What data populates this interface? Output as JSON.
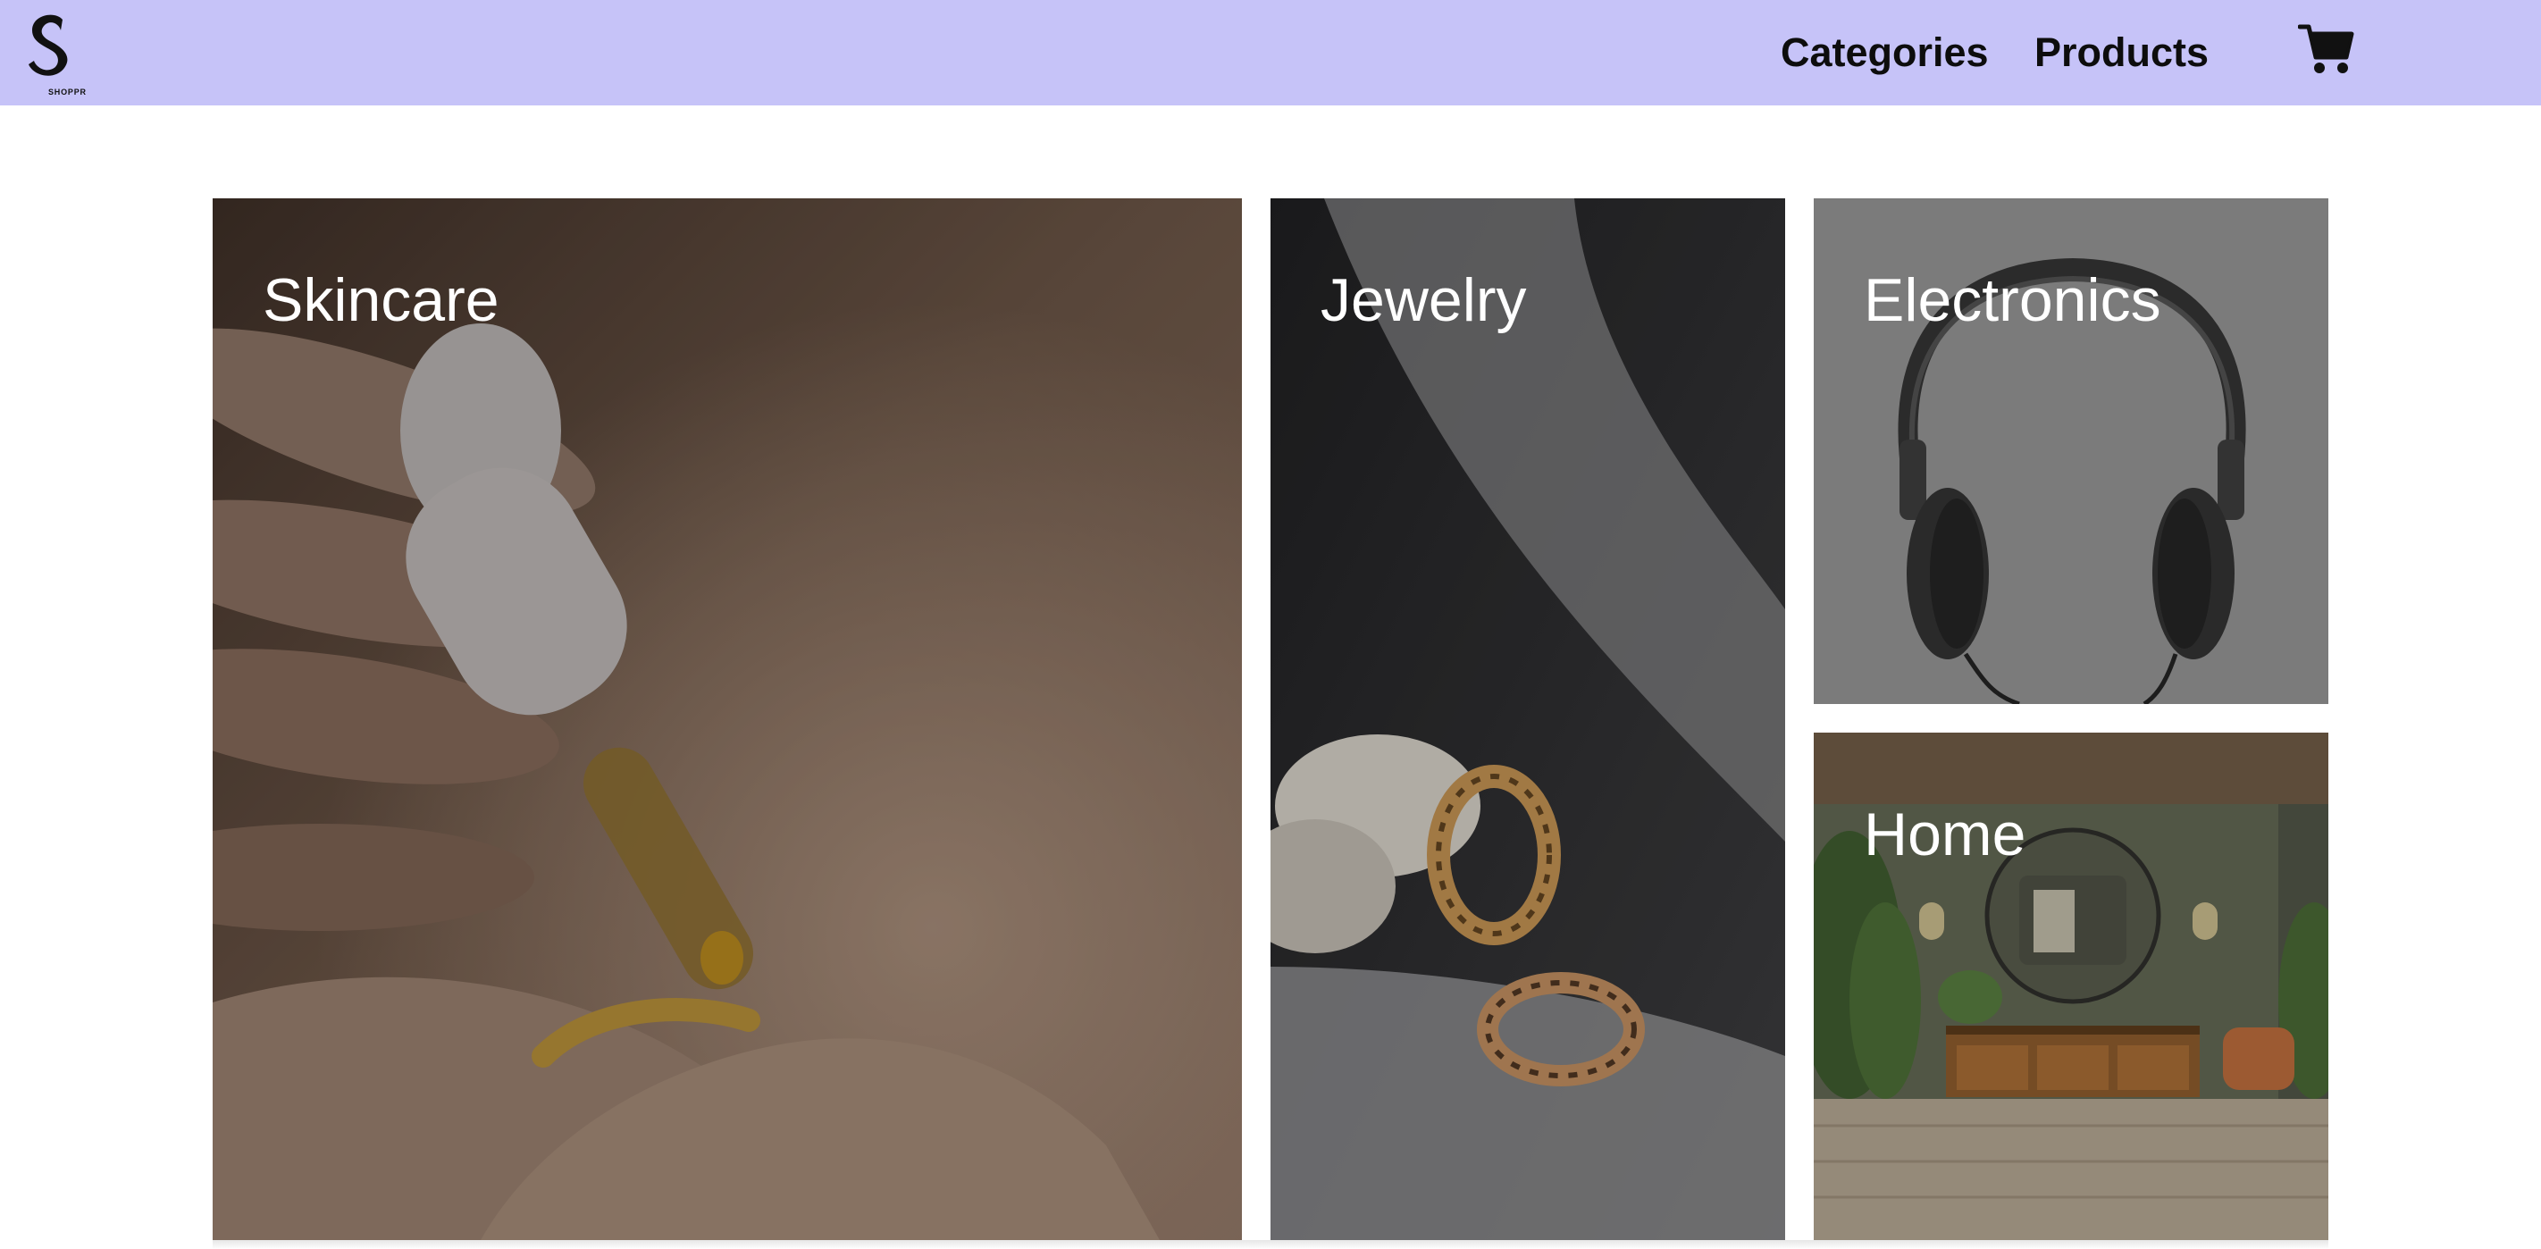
{
  "brand": {
    "logo_letter": "S",
    "name": "SHOPPR"
  },
  "nav": {
    "categories_label": "Categories",
    "products_label": "Products",
    "cart_icon": "cart-icon"
  },
  "tiles": [
    {
      "id": "skincare",
      "label": "Skincare"
    },
    {
      "id": "jewelry",
      "label": "Jewelry"
    },
    {
      "id": "electronics",
      "label": "Electronics"
    },
    {
      "id": "home",
      "label": "Home"
    }
  ],
  "colors": {
    "header_bg": "#c6c3f8",
    "label_text": "#ffffff",
    "nav_text": "#0d0d0d"
  }
}
